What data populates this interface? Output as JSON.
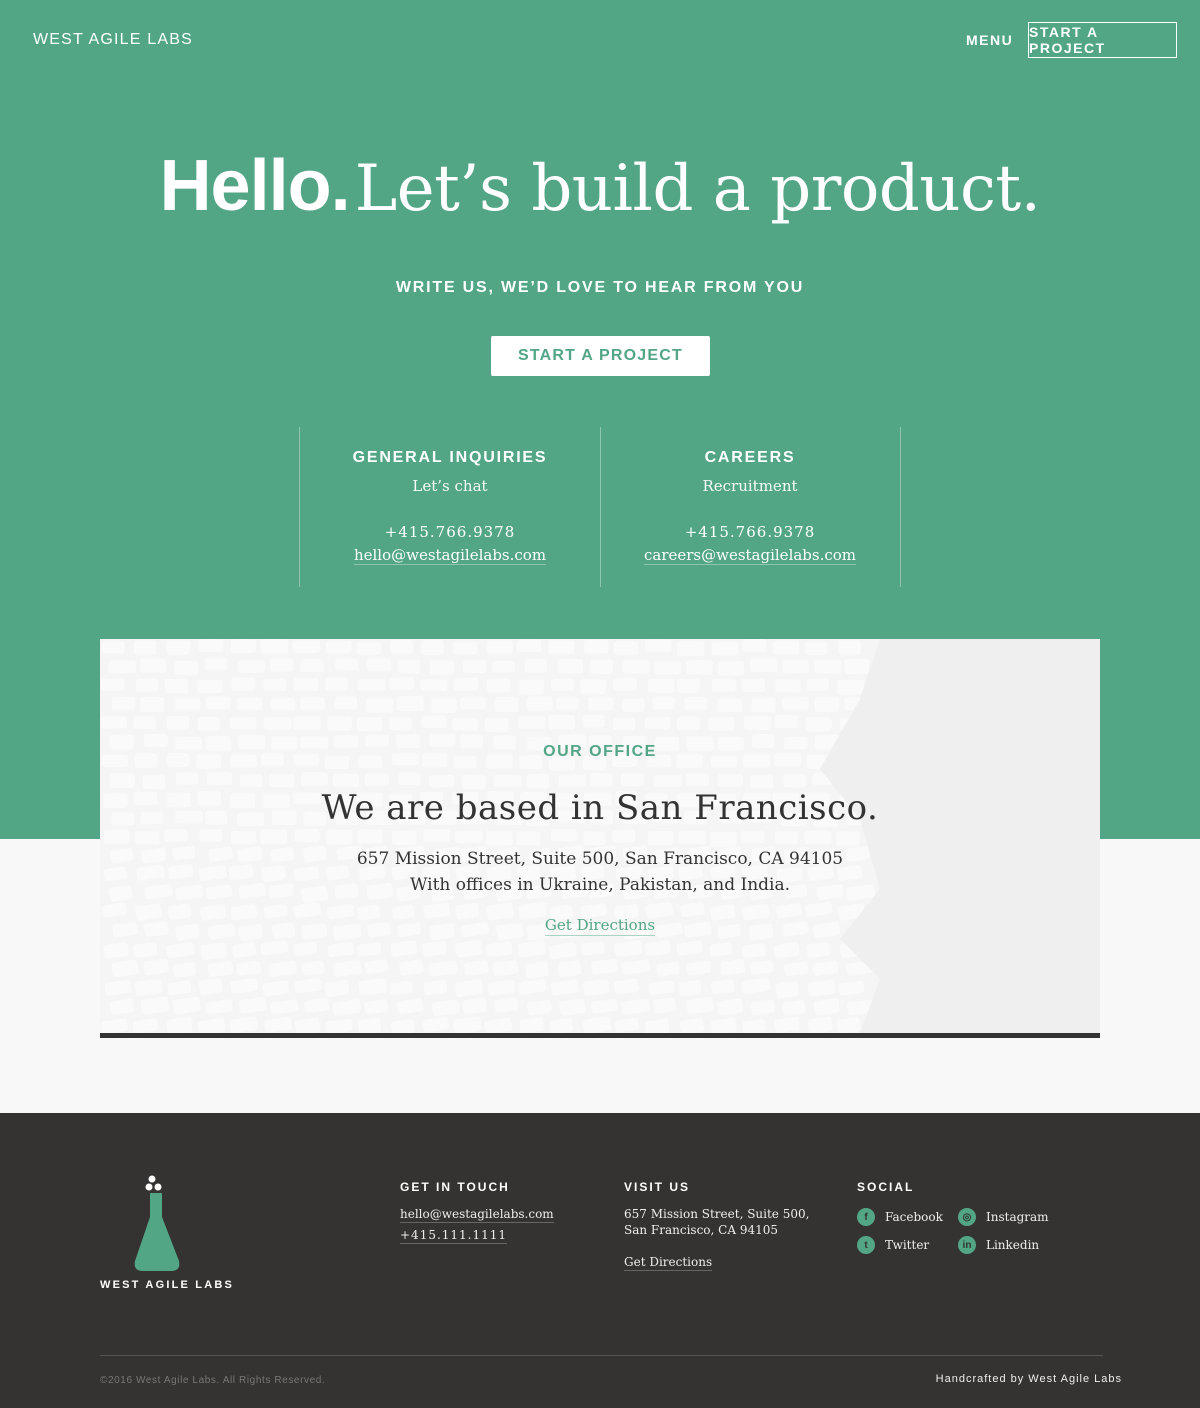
{
  "header": {
    "logo": "WEST AGILE LABS",
    "menu_label": "MENU",
    "cta_label": "START A PROJECT"
  },
  "hero": {
    "headline_bold": "Hello.",
    "headline_light": "Let’s build a product.",
    "subhead": "WRITE US, WE’D LOVE TO HEAR FROM YOU",
    "cta_label": "START A PROJECT"
  },
  "contacts": [
    {
      "title": "GENERAL INQUIRIES",
      "desc": "Let’s chat",
      "phone": "+415.766.9378",
      "email": "hello@westagilelabs.com"
    },
    {
      "title": "CAREERS",
      "desc": "Recruitment",
      "phone": "+415.766.9378",
      "email": "careers@westagilelabs.com"
    }
  ],
  "office": {
    "label": "OUR OFFICE",
    "heading": "We are based in San Francisco.",
    "address_line1": "657 Mission Street, Suite 500, San Francisco, CA 94105",
    "address_line2": "With offices in Ukraine, Pakistan, and India.",
    "directions": "Get Directions"
  },
  "footer": {
    "logo_text": "WEST AGILE LABS",
    "get_in_touch": {
      "heading": "GET IN TOUCH",
      "email": "hello@westagilelabs.com",
      "phone": "+415.111.1111"
    },
    "visit_us": {
      "heading": "VISIT US",
      "line1": "657 Mission Street, Suite 500,",
      "line2": "San Francisco, CA 94105",
      "directions": "Get Directions"
    },
    "social": {
      "heading": "SOCIAL",
      "items": [
        {
          "label": "Facebook",
          "icon": "facebook-icon",
          "glyph": "f"
        },
        {
          "label": "Instagram",
          "icon": "instagram-icon",
          "glyph": "◎"
        },
        {
          "label": "Twitter",
          "icon": "twitter-icon",
          "glyph": "t"
        },
        {
          "label": "Linkedin",
          "icon": "linkedin-icon",
          "glyph": "in"
        }
      ]
    },
    "copyright": "©2016 West Agile Labs. All Rights Reserved.",
    "credit": "Handcrafted by West Agile Labs"
  },
  "colors": {
    "accent": "#52a685",
    "footer_bg": "#343332",
    "page_bg": "#f8f8f8"
  }
}
